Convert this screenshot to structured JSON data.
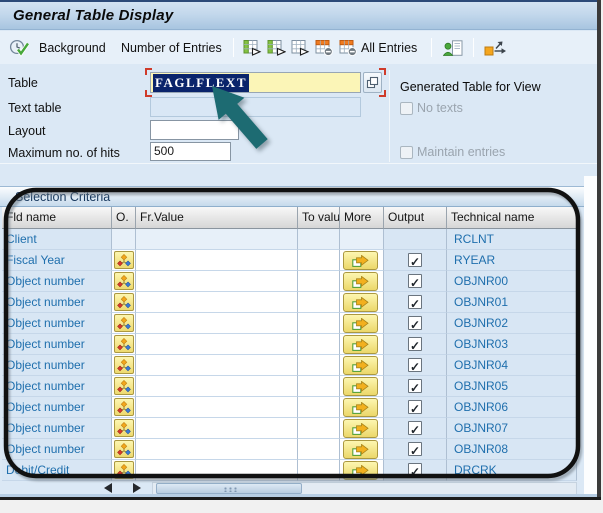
{
  "title_bar": {
    "title": "General Table Display"
  },
  "toolbar": {
    "background_label": "Background",
    "number_of_entries_label": "Number of Entries",
    "all_entries_label": "All Entries"
  },
  "form": {
    "table_label": "Table",
    "table_value": "FAGLFLEXT",
    "text_table_label": "Text table",
    "text_table_value": "",
    "layout_label": "Layout",
    "layout_value": "",
    "max_hits_label": "Maximum no. of hits",
    "max_hits_value": "500",
    "generated_table_label": "Generated Table for View",
    "no_texts": {
      "label": "No texts",
      "checked": false,
      "enabled": false
    },
    "maintain_entries": {
      "label": "Maintain entries",
      "checked": false,
      "enabled": false
    }
  },
  "selection": {
    "title": "Selection Criteria",
    "columns": [
      "Fld name",
      "O.",
      "Fr.Value",
      "To value",
      "More",
      "Output",
      "Technical name"
    ],
    "rows": [
      {
        "fld": "Client",
        "option": false,
        "more": false,
        "output": false,
        "tech": "RCLNT"
      },
      {
        "fld": "Fiscal Year",
        "option": true,
        "more": true,
        "output": true,
        "tech": "RYEAR"
      },
      {
        "fld": "Object number",
        "option": true,
        "more": true,
        "output": true,
        "tech": "OBJNR00"
      },
      {
        "fld": "Object number",
        "option": true,
        "more": true,
        "output": true,
        "tech": "OBJNR01"
      },
      {
        "fld": "Object number",
        "option": true,
        "more": true,
        "output": true,
        "tech": "OBJNR02"
      },
      {
        "fld": "Object number",
        "option": true,
        "more": true,
        "output": true,
        "tech": "OBJNR03"
      },
      {
        "fld": "Object number",
        "option": true,
        "more": true,
        "output": true,
        "tech": "OBJNR04"
      },
      {
        "fld": "Object number",
        "option": true,
        "more": true,
        "output": true,
        "tech": "OBJNR05"
      },
      {
        "fld": "Object number",
        "option": true,
        "more": true,
        "output": true,
        "tech": "OBJNR06"
      },
      {
        "fld": "Object number",
        "option": true,
        "more": true,
        "output": true,
        "tech": "OBJNR07"
      },
      {
        "fld": "Object number",
        "option": true,
        "more": true,
        "output": true,
        "tech": "OBJNR08"
      },
      {
        "fld": "Debit/Credit",
        "option": true,
        "more": true,
        "output": true,
        "tech": "DRCRK"
      }
    ]
  },
  "colors": {
    "row_blue": "#d8e6f4",
    "link_blue": "#1f6fad",
    "button_yellow": "#fdf6b0",
    "selection_highlight": "#0a246b",
    "annotation_teal": "#1d6b72",
    "annotation_black": "#111111"
  }
}
